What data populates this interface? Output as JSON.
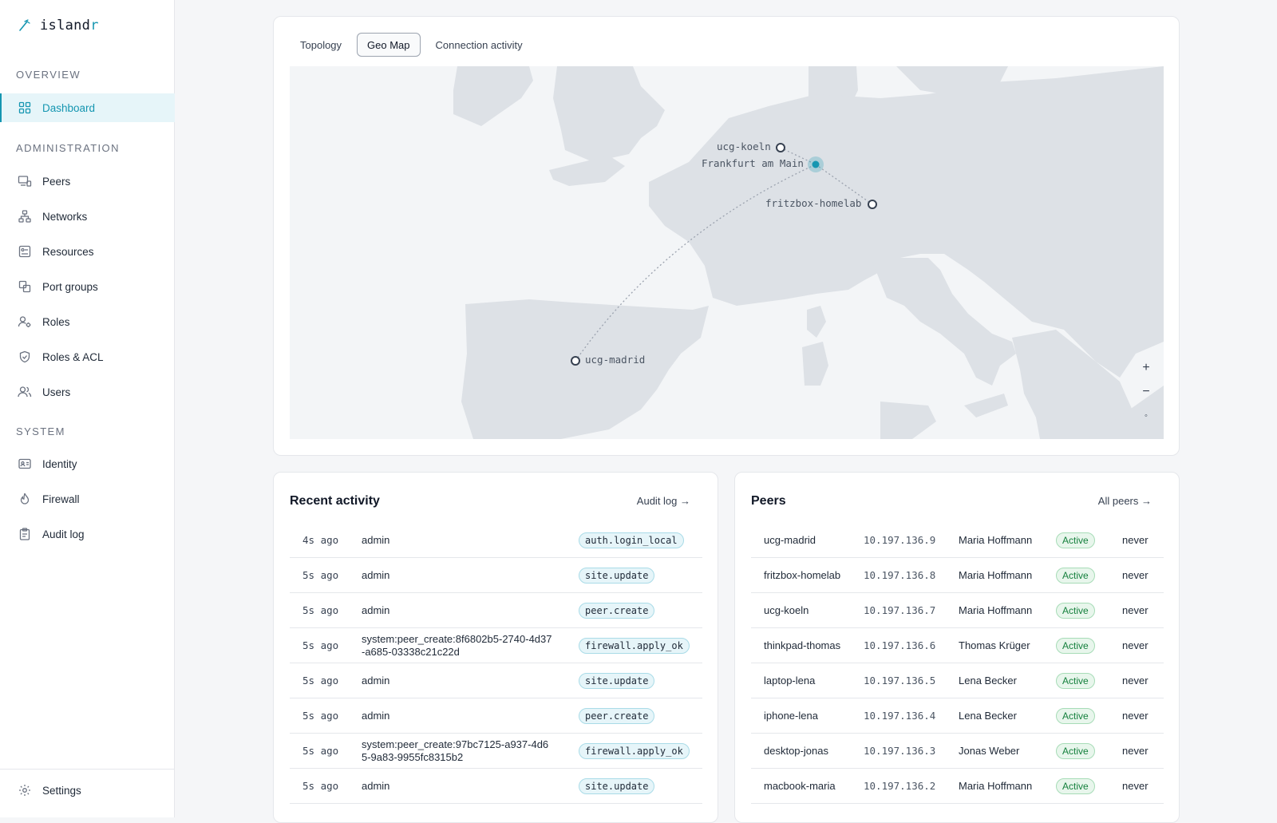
{
  "brand": {
    "name_main": "island",
    "name_accent": "r"
  },
  "sidebar": {
    "sections": [
      {
        "title": "OVERVIEW"
      },
      {
        "title": "ADMINISTRATION"
      },
      {
        "title": "SYSTEM"
      }
    ],
    "items": [
      {
        "label": "Dashboard",
        "icon": "grid-icon",
        "active": true
      },
      {
        "label": "Peers",
        "icon": "peers-icon"
      },
      {
        "label": "Networks",
        "icon": "network-icon"
      },
      {
        "label": "Resources",
        "icon": "resources-icon"
      },
      {
        "label": "Port groups",
        "icon": "port-groups-icon"
      },
      {
        "label": "Roles",
        "icon": "roles-icon"
      },
      {
        "label": "Roles & ACL",
        "icon": "shield-icon"
      },
      {
        "label": "Users",
        "icon": "users-icon"
      },
      {
        "label": "Identity",
        "icon": "id-card-icon"
      },
      {
        "label": "Firewall",
        "icon": "flame-icon"
      },
      {
        "label": "Audit log",
        "icon": "clipboard-icon"
      }
    ],
    "footer": {
      "label": "Settings",
      "icon": "gear-icon"
    }
  },
  "map_card": {
    "tabs": [
      {
        "label": "Topology"
      },
      {
        "label": "Geo Map",
        "active": true
      },
      {
        "label": "Connection activity"
      }
    ],
    "locations": [
      {
        "label": "ucg-koeln"
      },
      {
        "label": "Frankfurt am Main"
      },
      {
        "label": "fritzbox-homelab"
      },
      {
        "label": "ucg-madrid"
      }
    ],
    "zoom": {
      "in": "+",
      "out": "−",
      "reset": "◦"
    }
  },
  "activity": {
    "title": "Recent activity",
    "link": "Audit log →",
    "rows": [
      {
        "time": "4s ago",
        "actor": "admin",
        "event": "auth.login_local"
      },
      {
        "time": "5s ago",
        "actor": "admin",
        "event": "site.update"
      },
      {
        "time": "5s ago",
        "actor": "admin",
        "event": "peer.create"
      },
      {
        "time": "5s ago",
        "actor": "system:peer_create:8f6802b5-2740-4d37-a685-03338c21c22d",
        "event": "firewall.apply_ok"
      },
      {
        "time": "5s ago",
        "actor": "admin",
        "event": "site.update"
      },
      {
        "time": "5s ago",
        "actor": "admin",
        "event": "peer.create"
      },
      {
        "time": "5s ago",
        "actor": "system:peer_create:97bc7125-a937-4d65-9a83-9955fc8315b2",
        "event": "firewall.apply_ok"
      },
      {
        "time": "5s ago",
        "actor": "admin",
        "event": "site.update"
      }
    ]
  },
  "peers": {
    "title": "Peers",
    "link": "All peers →",
    "rows": [
      {
        "name": "ucg-madrid",
        "ip": "10.197.136.9",
        "owner": "Maria Hoffmann",
        "status": "Active",
        "last_seen": "never"
      },
      {
        "name": "fritzbox-homelab",
        "ip": "10.197.136.8",
        "owner": "Maria Hoffmann",
        "status": "Active",
        "last_seen": "never"
      },
      {
        "name": "ucg-koeln",
        "ip": "10.197.136.7",
        "owner": "Maria Hoffmann",
        "status": "Active",
        "last_seen": "never"
      },
      {
        "name": "thinkpad-thomas",
        "ip": "10.197.136.6",
        "owner": "Thomas Krüger",
        "status": "Active",
        "last_seen": "never"
      },
      {
        "name": "laptop-lena",
        "ip": "10.197.136.5",
        "owner": "Lena Becker",
        "status": "Active",
        "last_seen": "never"
      },
      {
        "name": "iphone-lena",
        "ip": "10.197.136.4",
        "owner": "Lena Becker",
        "status": "Active",
        "last_seen": "never"
      },
      {
        "name": "desktop-jonas",
        "ip": "10.197.136.3",
        "owner": "Jonas Weber",
        "status": "Active",
        "last_seen": "never"
      },
      {
        "name": "macbook-maria",
        "ip": "10.197.136.2",
        "owner": "Maria Hoffmann",
        "status": "Active",
        "last_seen": "never"
      }
    ]
  },
  "colors": {
    "accent": "#1596b1",
    "active_status": "#15803d",
    "land": "#dde1e6"
  }
}
